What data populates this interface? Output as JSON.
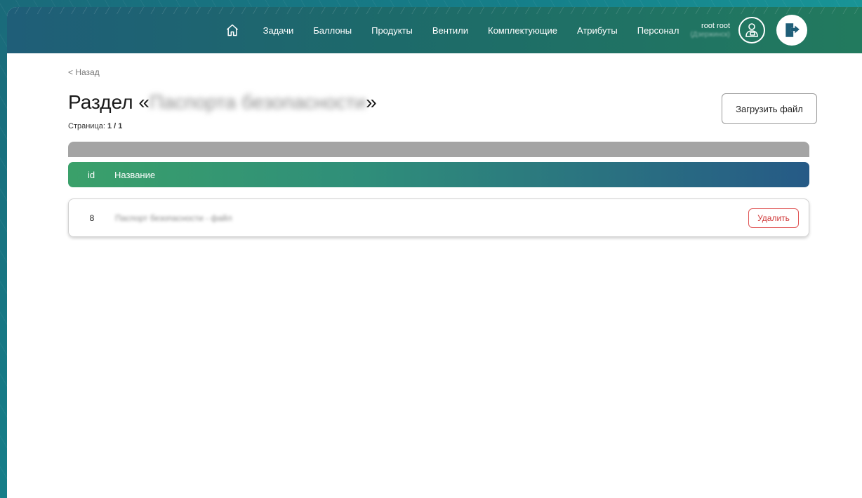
{
  "nav": {
    "home_icon": "home-icon",
    "items": [
      "Задачи",
      "Баллоны",
      "Продукты",
      "Вентили",
      "Комплектующие",
      "Атрибуты",
      "Персонал"
    ]
  },
  "user": {
    "name": "root root",
    "city": "(Дзержинск)",
    "avatar_icon": "user-icon",
    "logout_icon": "logout-icon"
  },
  "page": {
    "back_label": "< Назад",
    "title_prefix": "Раздел «",
    "title_name": "Паспорта безопасности",
    "title_suffix": "»",
    "page_label": "Страница:",
    "page_value": "1 / 1",
    "upload_label": "Загрузить файл"
  },
  "table": {
    "headers": {
      "id": "id",
      "name": "Название"
    },
    "rows": [
      {
        "id": "8",
        "name": "Паспорт безопасности - файл",
        "delete_label": "Удалить"
      }
    ]
  },
  "colors": {
    "accent_green": "#3aa06a",
    "accent_blue": "#265a86",
    "danger": "#d03a3a"
  }
}
